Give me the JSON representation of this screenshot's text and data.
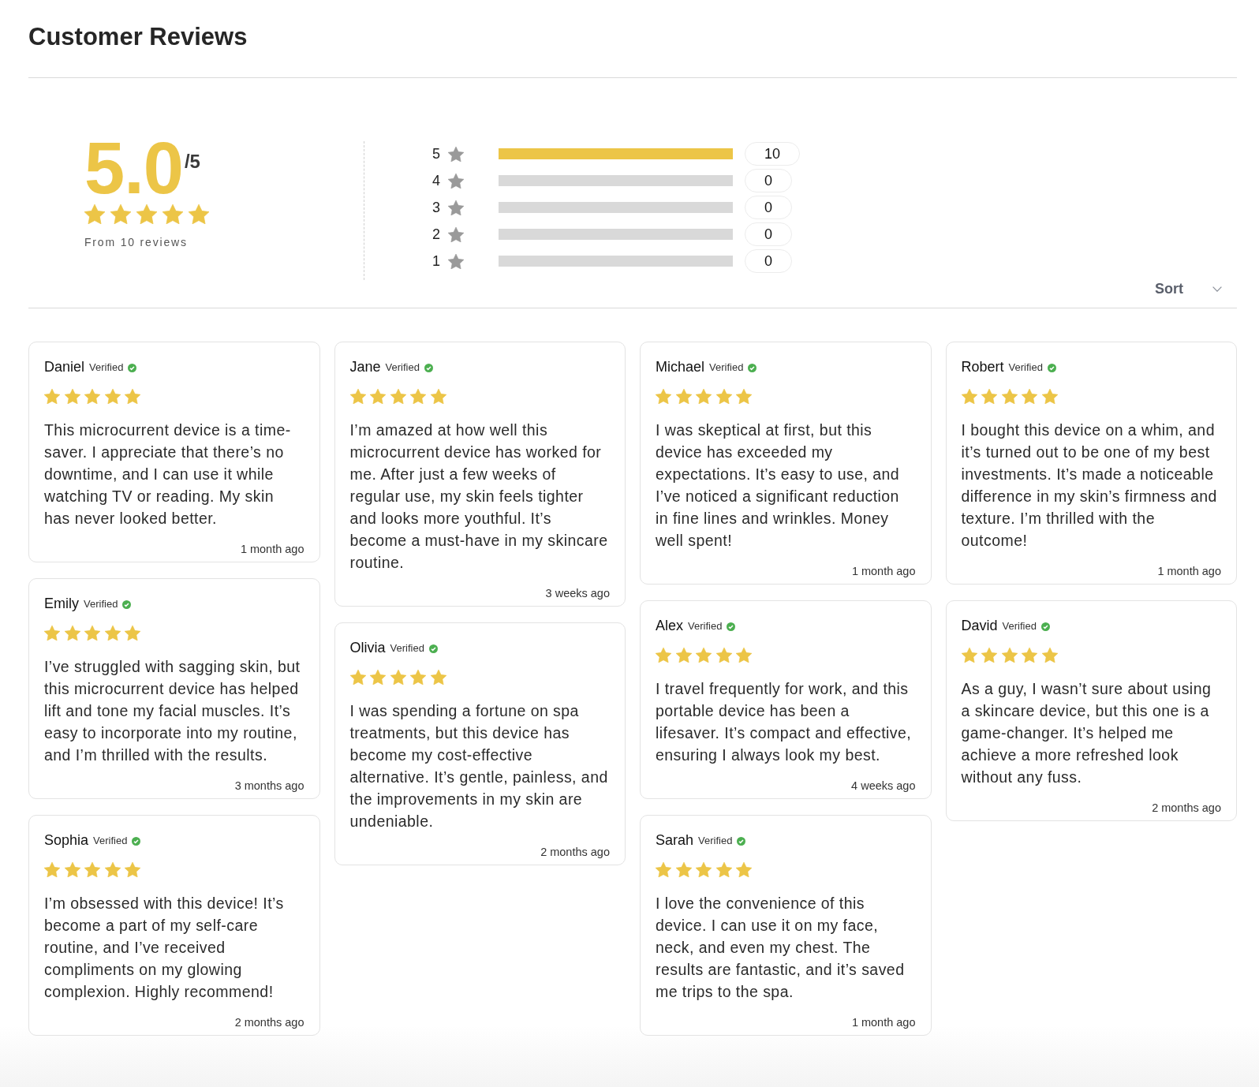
{
  "title": "Customer Reviews",
  "summary": {
    "average": "5.0",
    "out_of": "/5",
    "stars": 5,
    "caption": "From 10 reviews"
  },
  "distribution": [
    {
      "rating": "5",
      "count": "10",
      "level": 1
    },
    {
      "rating": "4",
      "count": "0",
      "level": 0
    },
    {
      "rating": "3",
      "count": "0",
      "level": 0
    },
    {
      "rating": "2",
      "count": "0",
      "level": 0
    },
    {
      "rating": "1",
      "count": "0",
      "level": 0
    }
  ],
  "sort": {
    "label": "Sort"
  },
  "review_columns": [
    {
      "reviews": [
        {
          "name": "Daniel",
          "badge": "Verified",
          "stars": 5,
          "text": "This microcurrent device is a time-saver. I appreciate that there’s no downtime, and I can use it while watching TV or reading. My skin has never looked better.",
          "date": "1 month ago"
        },
        {
          "name": "Emily",
          "badge": "Verified",
          "stars": 5,
          "text": "I’ve struggled with sagging skin, but this microcurrent device has helped lift and tone my facial muscles. It’s easy to incorporate into my routine, and I’m thrilled with the results.",
          "date": "3 months ago"
        },
        {
          "name": "Sophia",
          "badge": "Verified",
          "stars": 5,
          "text": "I’m obsessed with this device! It’s become a part of my self-care routine, and I’ve received compliments on my glowing complexion. Highly recommend!",
          "date": "2 months ago"
        }
      ]
    },
    {
      "reviews": [
        {
          "name": "Jane",
          "badge": "Verified",
          "stars": 5,
          "text": "I’m amazed at how well this microcurrent device has worked for me. After just a few weeks of regular use, my skin feels tighter and looks more youthful. It’s become a must-have in my skincare routine.",
          "date": "3 weeks ago"
        },
        {
          "name": "Olivia",
          "badge": "Verified",
          "stars": 5,
          "text": "I was spending a fortune on spa treatments, but this device has become my cost-effective alternative. It’s gentle, painless, and the improvements in my skin are undeniable.",
          "date": "2 months ago"
        }
      ]
    },
    {
      "reviews": [
        {
          "name": "Michael",
          "badge": "Verified",
          "stars": 5,
          "text": "I was skeptical at first, but this device has exceeded my expectations. It’s easy to use, and I’ve noticed a significant reduction in fine lines and wrinkles. Money well spent!",
          "date": "1 month ago"
        },
        {
          "name": "Alex",
          "badge": "Verified",
          "stars": 5,
          "text": "I travel frequently for work, and this portable device has been a lifesaver. It’s compact and effective, ensuring I always look my best.",
          "date": "4 weeks ago"
        },
        {
          "name": "Sarah",
          "badge": "Verified",
          "stars": 5,
          "text": "I love the convenience of this device. I can use it on my face, neck, and even my chest. The results are fantastic, and it’s saved me trips to the spa.",
          "date": "1 month ago"
        }
      ]
    },
    {
      "reviews": [
        {
          "name": "Robert",
          "badge": "Verified",
          "stars": 5,
          "text": "I bought this device on a whim, and it’s turned out to be one of my best investments. It’s made a noticeable difference in my skin’s firmness and texture. I’m thrilled with the outcome!",
          "date": "1 month ago"
        },
        {
          "name": "David",
          "badge": "Verified",
          "stars": 5,
          "text": "As a guy, I wasn’t sure about using a skincare device, but this one is a game-changer. It’s helped me achieve a more refreshed look without any fuss.",
          "date": "2 months ago"
        }
      ]
    }
  ]
}
